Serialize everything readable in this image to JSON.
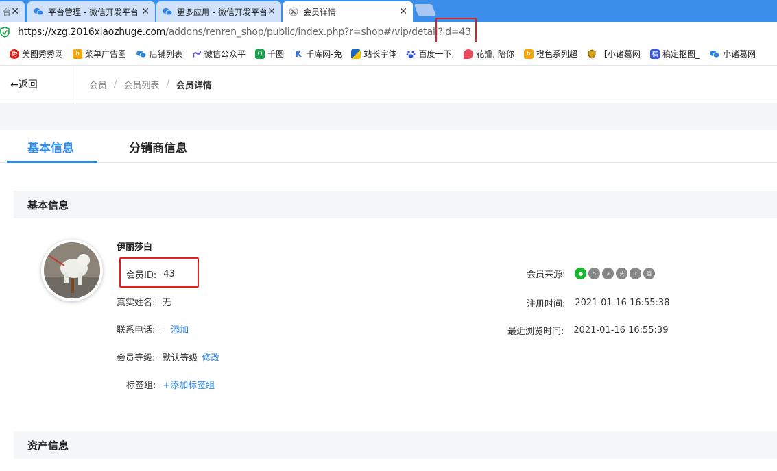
{
  "browser": {
    "tabs": [
      {
        "label": "台",
        "active": false
      },
      {
        "label": "平台管理 - 微信开发平台",
        "active": false
      },
      {
        "label": "更多应用 - 微信开发平台",
        "active": false
      },
      {
        "label": "会员详情",
        "active": true
      }
    ],
    "close_glyph": "✕",
    "url_main": "https://xzg.2016xiaozhuge.com",
    "url_rest": "/addons/renren_shop/public/index.php?r=shop#/vip/detail?id=43"
  },
  "bookmarks": [
    {
      "label": "美图秀秀网",
      "color": "#e2261d",
      "glyph": "秀"
    },
    {
      "label": "菜单广告图",
      "color": "#f2a60f",
      "glyph": "b"
    },
    {
      "label": "店铺列表",
      "color": "#2a82e4",
      "glyph": ""
    },
    {
      "label": "微信公众平",
      "color": "#6b4fcf",
      "glyph": ""
    },
    {
      "label": "千图",
      "color": "#1aa34a",
      "glyph": "Q"
    },
    {
      "label": "千库网-免",
      "color": "#2b6be0",
      "glyph": "K"
    },
    {
      "label": "站长字体",
      "color": "#1867c0",
      "glyph": ""
    },
    {
      "label": "百度一下,",
      "color": "#2b52e0",
      "glyph": ""
    },
    {
      "label": "花瓣, 陪你",
      "color": "#e84b5a",
      "glyph": ""
    },
    {
      "label": "橙色系列超",
      "color": "#f2a60f",
      "glyph": "b"
    },
    {
      "label": "【小诸葛网",
      "color": "#d4a017",
      "glyph": ""
    },
    {
      "label": "稿定抠图_",
      "color": "#3a5bd9",
      "glyph": "稿"
    },
    {
      "label": "小诸葛网",
      "color": "#2a82e4",
      "glyph": ""
    }
  ],
  "header": {
    "back_label": "←返回",
    "breadcrumb": [
      "会员",
      "会员列表",
      "会员详情"
    ],
    "sep": "/"
  },
  "page_tabs": [
    {
      "label": "基本信息",
      "active": true
    },
    {
      "label": "分销商信息",
      "active": false
    }
  ],
  "basic": {
    "section_title": "基本信息",
    "name": "伊丽莎白",
    "id_label": "会员ID:",
    "id_value": "43",
    "realname_label": "真实姓名:",
    "realname_value": "无",
    "phone_label": "联系电话:",
    "phone_value": "-",
    "phone_add": "添加",
    "level_label": "会员等级:",
    "level_value": "默认等级",
    "level_edit": "修改",
    "tag_label": "标签组:",
    "tag_add": "+添加标签组",
    "source_label": "会员来源:",
    "source_icons": [
      "wechat-icon",
      "h5-icon",
      "mini-program-icon",
      "toutiao-icon",
      "douyin-icon",
      "baidu-icon"
    ],
    "reg_label": "注册时间:",
    "reg_value": "2021-01-16 16:55:38",
    "visit_label": "最近浏览时间:",
    "visit_value": "2021-01-16 16:55:39"
  },
  "assets": {
    "section_title": "资产信息"
  },
  "colors": {
    "tab_strip": "#3b8eea",
    "accent": "#2d8cf0",
    "highlight": "#e02020"
  }
}
